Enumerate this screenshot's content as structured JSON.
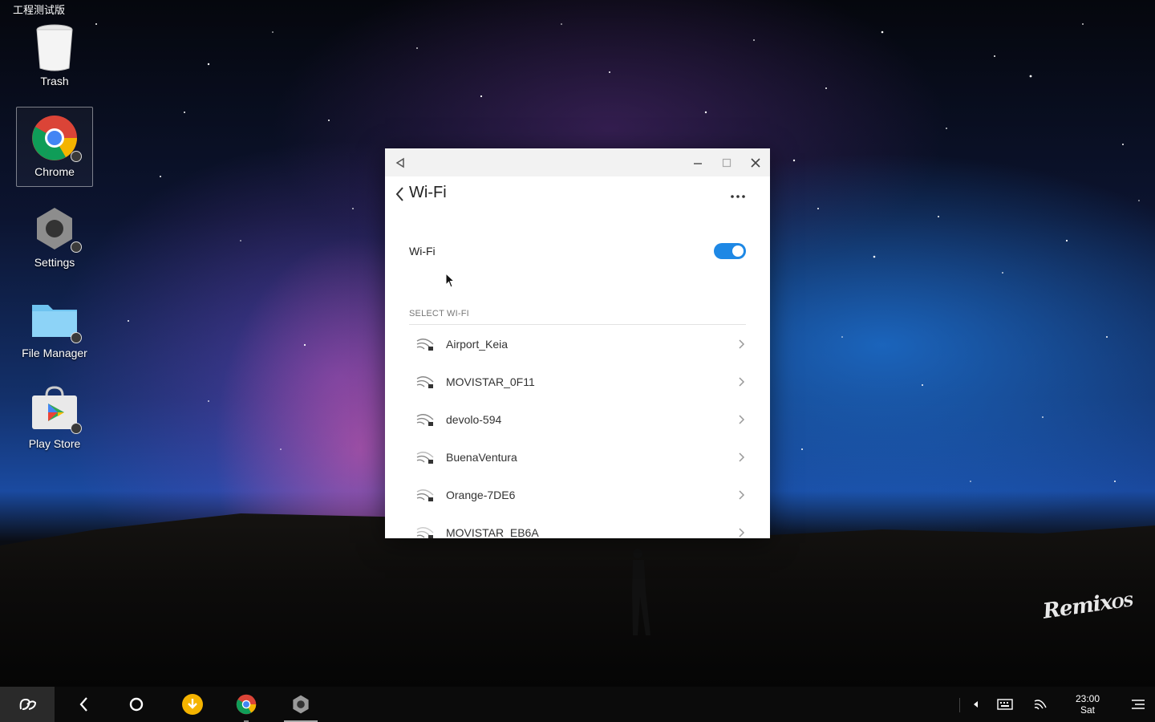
{
  "system": {
    "build_label": "工程测试版"
  },
  "desktop": {
    "icons": [
      {
        "label": "Trash",
        "icon": "trash-icon"
      },
      {
        "label": "Chrome",
        "icon": "chrome-icon"
      },
      {
        "label": "Settings",
        "icon": "settings-gear-icon"
      },
      {
        "label": "File Manager",
        "icon": "folder-icon"
      },
      {
        "label": "Play Store",
        "icon": "play-store-icon"
      }
    ],
    "brand": "Remix OS"
  },
  "window": {
    "title": "Wi-Fi",
    "wifi_toggle": {
      "label": "Wi-Fi",
      "on": true,
      "accent": "#1e88e5"
    },
    "section_label": "SELECT WI-FI",
    "networks": [
      {
        "name": "Airport_Keia"
      },
      {
        "name": "MOVISTAR_0F11"
      },
      {
        "name": "devolo-594"
      },
      {
        "name": "BuenaVentura"
      },
      {
        "name": "Orange-7DE6"
      },
      {
        "name": "MOVISTAR_EB6A"
      }
    ]
  },
  "taskbar": {
    "clock_time": "23:00",
    "clock_day": "Sat"
  }
}
